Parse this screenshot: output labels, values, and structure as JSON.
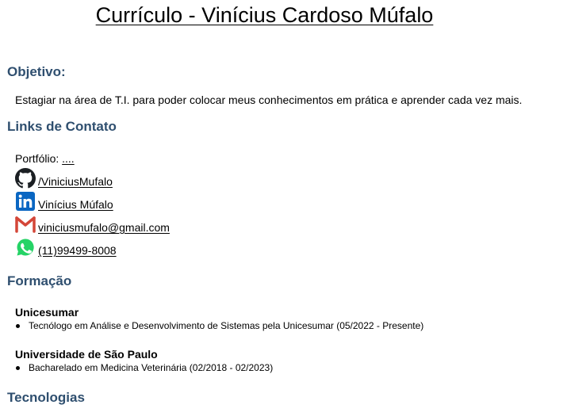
{
  "title": "Currículo - Vinícius Cardoso Múfalo",
  "objetivo": {
    "heading": "Objetivo:",
    "text": "Estagiar na área de T.I. para poder colocar meus conhecimentos em prática e aprender cada vez mais."
  },
  "links": {
    "heading": "Links de Contato",
    "portfolio_label": "Portfólio:",
    "portfolio_link": "....",
    "items": [
      {
        "icon": "github-icon",
        "text": "/ViniciusMufalo"
      },
      {
        "icon": "linkedin-icon",
        "text": "Vinícius Múfalo"
      },
      {
        "icon": "gmail-icon",
        "text": "viniciusmufalo@gmail.com"
      },
      {
        "icon": "whatsapp-icon",
        "text": "(11)99499-8008"
      }
    ]
  },
  "formacao": {
    "heading": "Formação",
    "institutions": [
      {
        "name": "Unicesumar",
        "course": "Tecnólogo em Análise e Desenvolvimento de Sistemas pela Unicesumar (05/2022 - Presente)"
      },
      {
        "name": "Universidade de São Paulo",
        "course": "Bacharelado em Medicina Veterinária (02/2018 - 02/2023)"
      }
    ]
  },
  "tecnologias": {
    "heading": "Tecnologias"
  },
  "colors": {
    "heading": "#2f4f6f",
    "linkedin": "#0a66c2",
    "gmail": "#d44638",
    "whatsapp": "#25d366"
  }
}
